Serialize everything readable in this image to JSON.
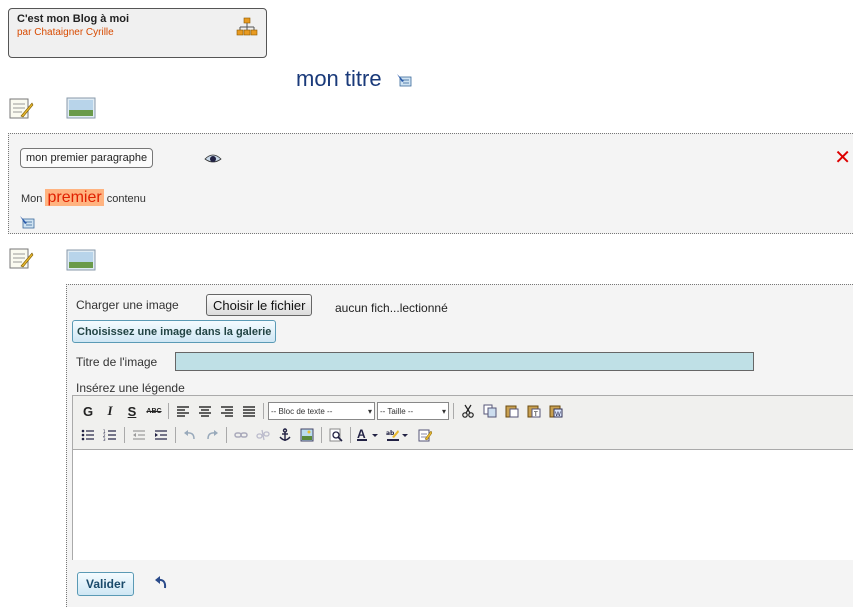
{
  "header": {
    "blog_title": "C'est mon Blog à moi",
    "blog_author": "par Chataigner Cyrille",
    "sitemap_icon": "sitemap-icon"
  },
  "page": {
    "title": "mon titre"
  },
  "paragraph": {
    "title": "mon premier paragraphe",
    "content_before": "Mon ",
    "content_highlight": "premier",
    "content_after": " contenu",
    "close_symbol": "✕"
  },
  "editor": {
    "upload_label": "Charger une image",
    "choose_file_button": "Choisir le fichier",
    "no_file_text": "aucun fich...lectionné",
    "gallery_button": "Choisissez une image dans la galerie",
    "image_title_label": "Titre de l'image",
    "image_title_value": "",
    "caption_label": "Insérez une légende",
    "toolbar": {
      "bold": "G",
      "italic": "I",
      "underline": "S",
      "strike": "ABC",
      "block_select": "-- Bloc de texte --",
      "size_select": "-- Taille --"
    },
    "submit_button": "Valider"
  },
  "colors": {
    "accent": "#1a3a7a",
    "author": "#d84a00",
    "highlight_bg": "#ffb380",
    "highlight_fg": "#e02000",
    "input_bg": "#bfe0e6"
  }
}
